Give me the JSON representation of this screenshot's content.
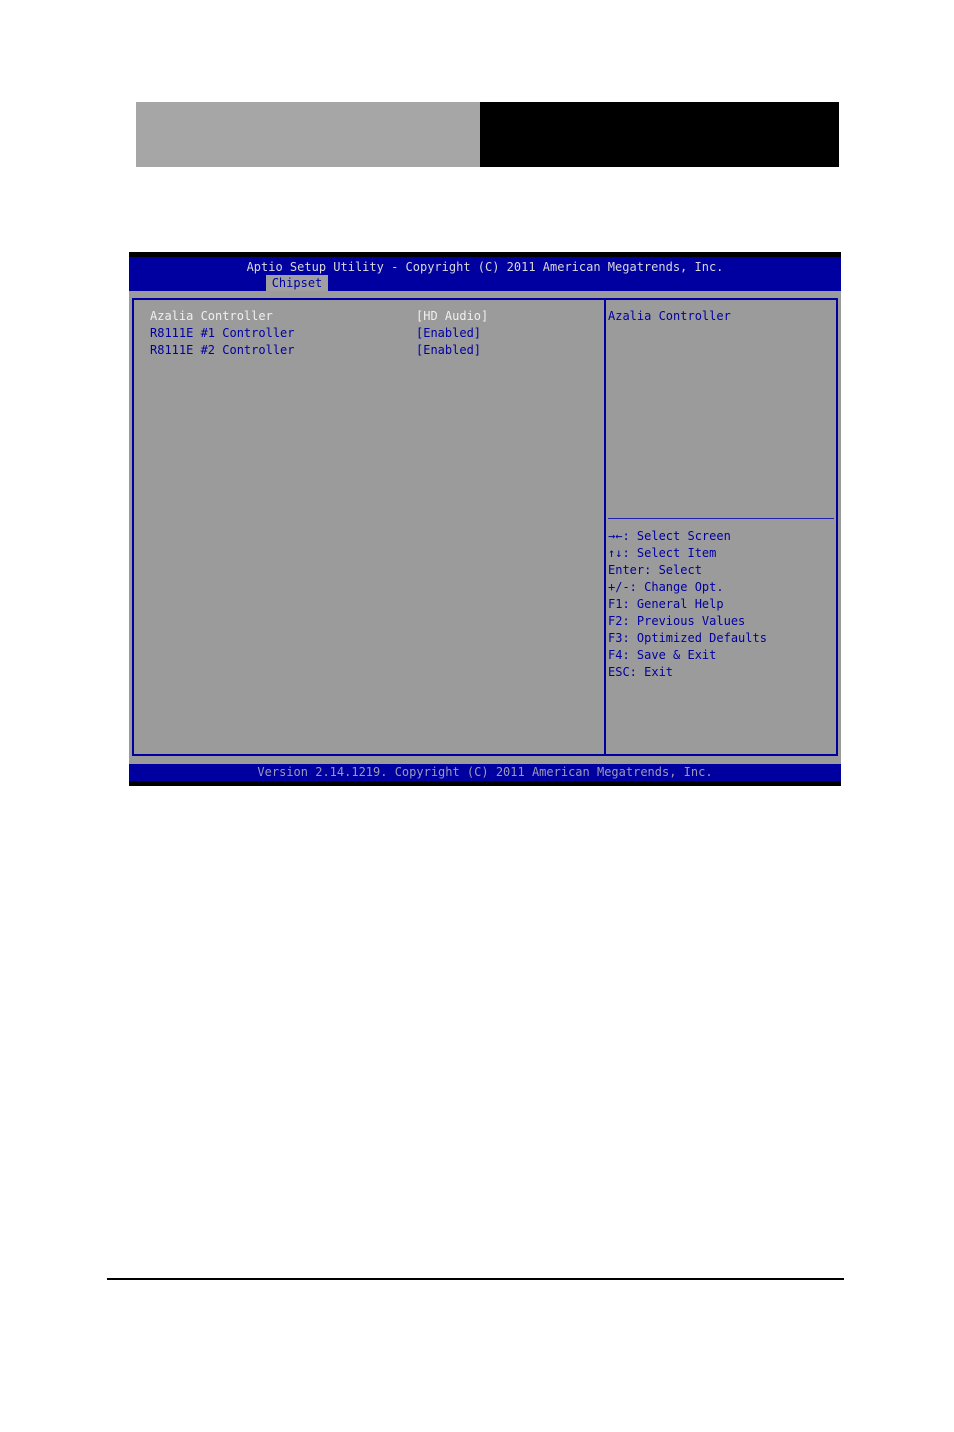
{
  "bios": {
    "title": "Aptio Setup Utility - Copyright (C) 2011 American Megatrends, Inc.",
    "active_tab": "Chipset",
    "settings": [
      {
        "label": "Azalia Controller",
        "value": "[HD Audio]",
        "selected": true
      },
      {
        "label": "R8111E #1 Controller",
        "value": "[Enabled]",
        "selected": false
      },
      {
        "label": "R8111E #2 Controller",
        "value": "[Enabled]",
        "selected": false
      }
    ],
    "help_text": "Azalia Controller",
    "key_help": [
      {
        "icon": "left-right-arrows-icon",
        "glyph": "→←",
        "text": ": Select Screen"
      },
      {
        "icon": "up-down-arrows-icon",
        "glyph": "↑↓",
        "text": ": Select Item"
      },
      {
        "text": "Enter: Select"
      },
      {
        "text": "+/-: Change Opt."
      },
      {
        "text": "F1: General Help"
      },
      {
        "text": "F2: Previous Values"
      },
      {
        "text": "F3: Optimized Defaults"
      },
      {
        "text": "F4: Save & Exit"
      },
      {
        "text": "ESC: Exit"
      }
    ],
    "footer": "Version 2.14.1219. Copyright (C) 2011 American Megatrends, Inc."
  },
  "colors": {
    "bios_blue": "#0000a0",
    "bios_grey": "#9b9b9b",
    "selected_text": "#f0f0f0"
  }
}
